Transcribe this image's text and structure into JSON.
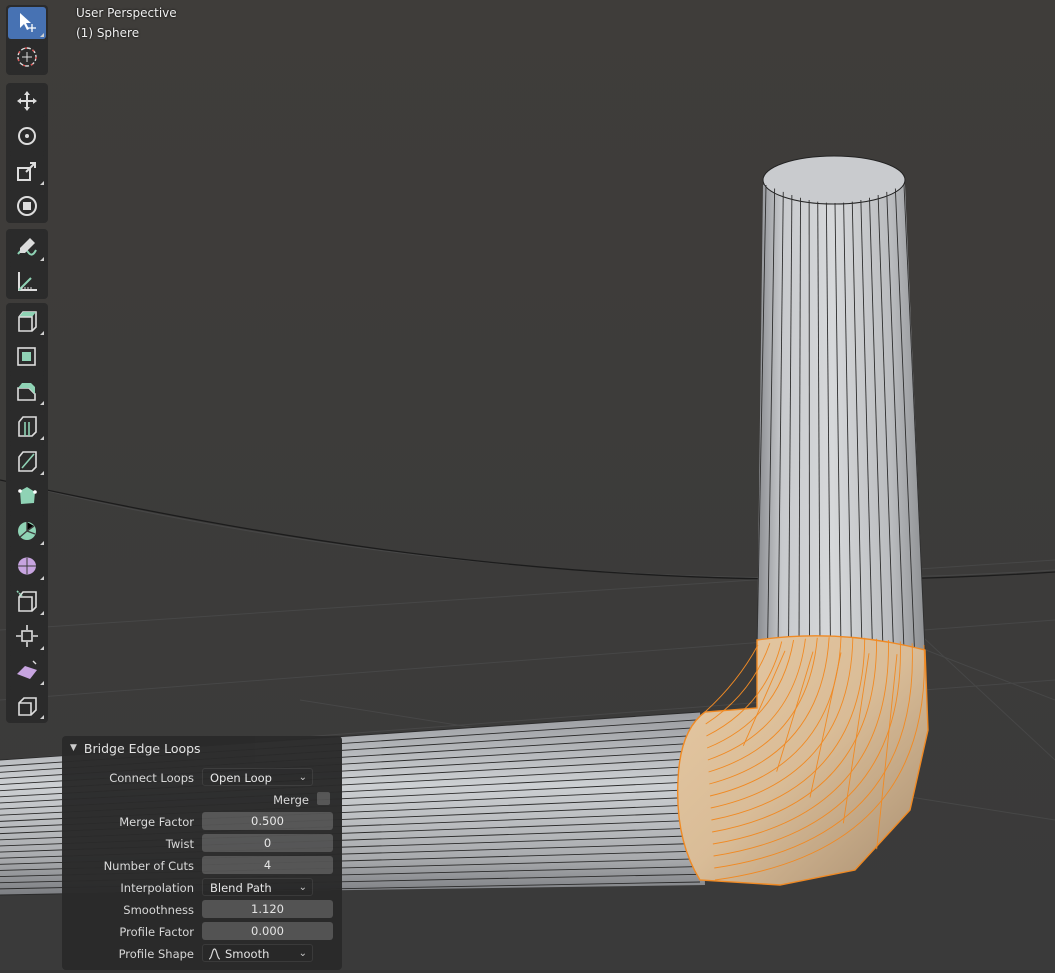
{
  "viewport": {
    "perspective_label": "User Perspective",
    "object_label": "(1) Sphere"
  },
  "toolbar": {
    "tools": [
      {
        "name": "select-box-icon",
        "active": true
      },
      {
        "name": "cursor-icon",
        "active": false
      },
      {
        "name": "move-icon",
        "active": false
      },
      {
        "name": "rotate-icon",
        "active": false
      },
      {
        "name": "scale-icon",
        "active": false
      },
      {
        "name": "transform-icon",
        "active": false
      },
      {
        "name": "annotate-icon",
        "active": false
      },
      {
        "name": "measure-icon",
        "active": false
      },
      {
        "name": "extrude-region-icon",
        "active": false
      },
      {
        "name": "inset-faces-icon",
        "active": false
      },
      {
        "name": "bevel-icon",
        "active": false
      },
      {
        "name": "loop-cut-icon",
        "active": false
      },
      {
        "name": "knife-icon",
        "active": false
      },
      {
        "name": "poly-build-icon",
        "active": false
      },
      {
        "name": "spin-icon",
        "active": false
      },
      {
        "name": "smooth-icon",
        "active": false
      },
      {
        "name": "edge-slide-icon",
        "active": false
      },
      {
        "name": "shrink-fatten-icon",
        "active": false
      },
      {
        "name": "shear-icon",
        "active": false
      },
      {
        "name": "rip-region-icon",
        "active": false
      }
    ]
  },
  "operator_panel": {
    "title": "Bridge Edge Loops",
    "connect_loops_label": "Connect Loops",
    "connect_loops_value": "Open Loop",
    "merge_label": "Merge",
    "merge_checked": false,
    "merge_factor_label": "Merge Factor",
    "merge_factor_value": "0.500",
    "twist_label": "Twist",
    "twist_value": "0",
    "number_of_cuts_label": "Number of Cuts",
    "number_of_cuts_value": "4",
    "interpolation_label": "Interpolation",
    "interpolation_value": "Blend Path",
    "smoothness_label": "Smoothness",
    "smoothness_value": "1.120",
    "profile_factor_label": "Profile Factor",
    "profile_factor_value": "0.000",
    "profile_shape_label": "Profile Shape",
    "profile_shape_value": "Smooth"
  },
  "colors": {
    "viewport_bg": "#3d3d3d",
    "selection_orange": "#f08a24",
    "active_tool": "#4772b3",
    "tool_green": "#8fd3b5"
  }
}
